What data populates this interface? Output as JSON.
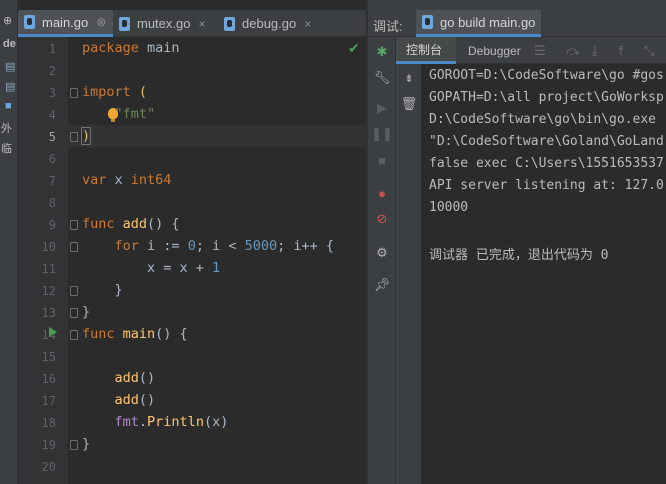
{
  "left_panel": {
    "items": [
      "de",
      "外",
      "临"
    ]
  },
  "tabs": [
    {
      "label": "main.go",
      "active": true
    },
    {
      "label": "mutex.go",
      "active": false
    },
    {
      "label": "debug.go",
      "active": false
    }
  ],
  "editor": {
    "current_line": 5,
    "line_numbers": [
      "1",
      "2",
      "3",
      "4",
      "5",
      "6",
      "7",
      "8",
      "9",
      "10",
      "11",
      "12",
      "13",
      "14",
      "15",
      "16",
      "17",
      "18",
      "19",
      "20"
    ]
  },
  "debug": {
    "title": "调试:",
    "run_config": "go build main.go",
    "subtabs": [
      {
        "label": "控制台",
        "active": true
      },
      {
        "label": "Debugger",
        "active": false
      }
    ],
    "console": [
      "GOROOT=D:\\CodeSoftware\\go #gos",
      "GOPATH=D:\\all project\\GoWorksp",
      "D:\\CodeSoftware\\go\\bin\\go.exe",
      "\"D:\\CodeSoftware\\Goland\\GoLand",
      "false exec C:\\Users\\1551653537",
      "API server listening at: 127.0",
      "10000",
      "",
      "调试器 已完成，退出代码为 0"
    ]
  },
  "colors": {
    "accent": "#4a88c7",
    "run": "#499c54",
    "keyword": "#cc7832",
    "string": "#6a8759",
    "number": "#6897bb",
    "function": "#ffc66d"
  }
}
